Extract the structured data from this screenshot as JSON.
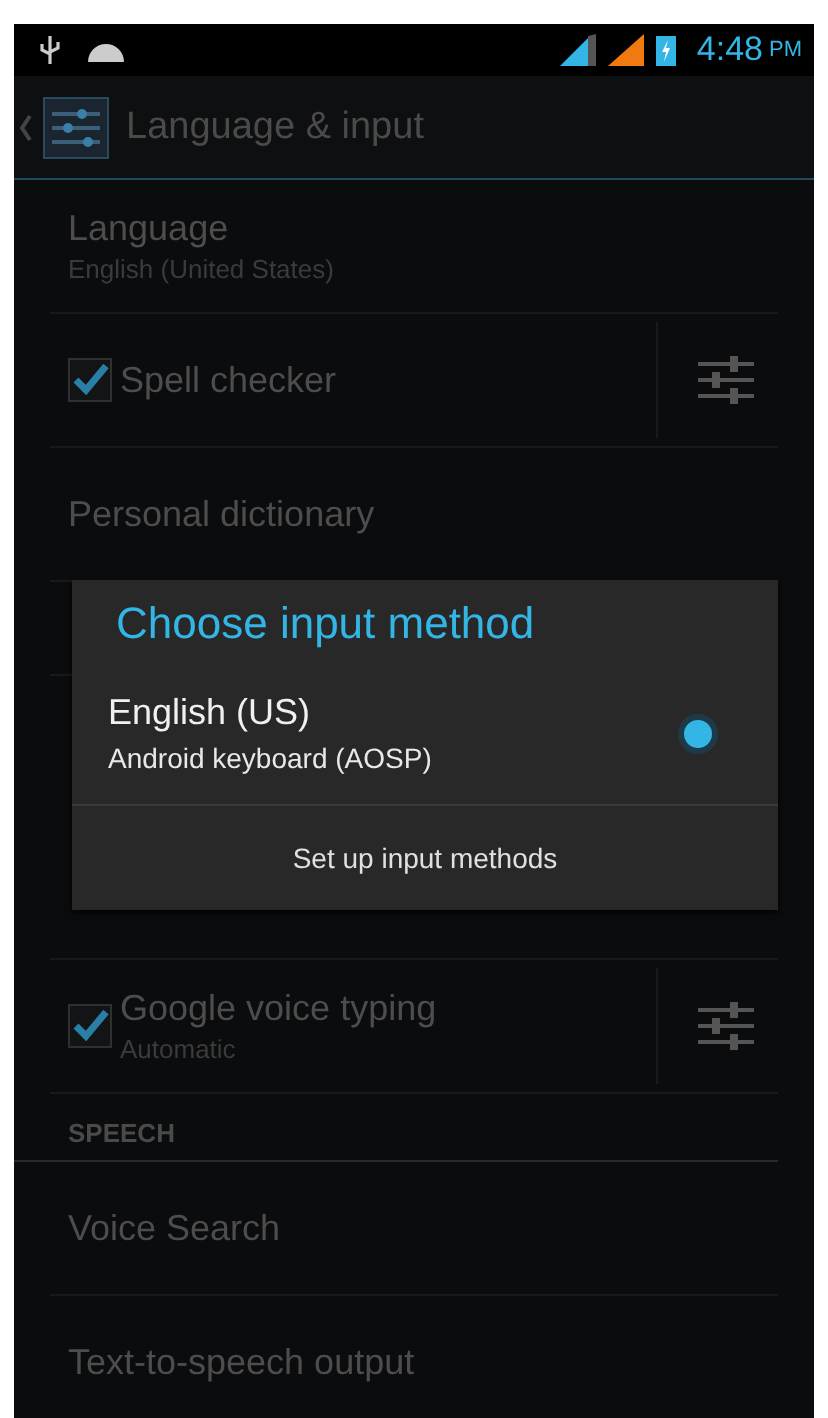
{
  "status_bar": {
    "time": "4:48",
    "am_pm": "PM"
  },
  "action_bar": {
    "title": "Language & input"
  },
  "settings": [
    {
      "kind": "item",
      "title": "Language",
      "summary": "English (United States)"
    },
    {
      "kind": "check",
      "title": "Spell checker",
      "checked": true
    },
    {
      "kind": "item",
      "title": "Personal dictionary"
    },
    {
      "kind": "covered"
    },
    {
      "kind": "check",
      "title": "Google voice typing",
      "summary": "Automatic",
      "checked": true
    },
    {
      "kind": "header",
      "title": "SPEECH"
    },
    {
      "kind": "item",
      "title": "Voice Search"
    },
    {
      "kind": "item",
      "title": "Text-to-speech output"
    }
  ],
  "dialog": {
    "title": "Choose input method",
    "options": [
      {
        "title": "English (US)",
        "summary": "Android keyboard (AOSP)",
        "selected": true
      }
    ],
    "button": "Set up input methods"
  }
}
